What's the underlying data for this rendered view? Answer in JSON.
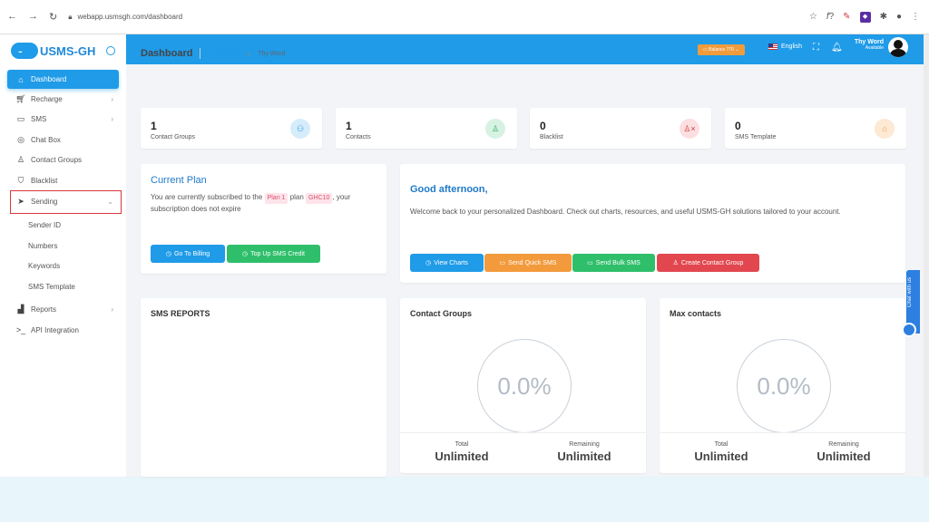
{
  "browser": {
    "url": "webapp.usmsgh.com/dashboard"
  },
  "logo": {
    "text": "USMS-GH",
    "mark": "..."
  },
  "sidebar": {
    "items": [
      {
        "label": "Dashboard",
        "icon": "home-icon"
      },
      {
        "label": "Recharge",
        "icon": "cart-icon"
      },
      {
        "label": "SMS",
        "icon": "message-icon"
      },
      {
        "label": "Chat Box",
        "icon": "chat-icon"
      },
      {
        "label": "Contact Groups",
        "icon": "user-icon"
      },
      {
        "label": "Blacklist",
        "icon": "shield-icon"
      },
      {
        "label": "Sending",
        "icon": "send-icon"
      }
    ],
    "sub_items": [
      "Sender ID",
      "Numbers",
      "Keywords",
      "SMS Template"
    ],
    "items2": [
      {
        "label": "Reports",
        "icon": "bar-chart-icon"
      },
      {
        "label": "API Integration",
        "icon": "terminal-icon"
      }
    ]
  },
  "topbar": {
    "balance": "Balance 770",
    "language": "English",
    "user_name": "Thy Word",
    "user_status": "Available"
  },
  "breadcrumb": {
    "title": "Dashboard",
    "link": "Dashboard",
    "separator": "»",
    "current": "Thy Word"
  },
  "stats": [
    {
      "value": "1",
      "label": "Contact Groups",
      "icon": "users-icon",
      "color": "#1f9be8",
      "bg": "#d6ecfb"
    },
    {
      "value": "1",
      "label": "Contacts",
      "icon": "user-icon",
      "color": "#27ae60",
      "bg": "#d7f2e2"
    },
    {
      "value": "0",
      "label": "Blacklist",
      "icon": "user-x-icon",
      "color": "#d9363e",
      "bg": "#fbdfe1"
    },
    {
      "value": "0",
      "label": "SMS Template",
      "icon": "inbox-icon",
      "color": "#f09c3c",
      "bg": "#fde9d4"
    }
  ],
  "plan": {
    "title": "Current Plan",
    "text_before": "You are currently subscribed to the",
    "plan_tag": "Plan 1",
    "text_mid": "plan",
    "price_tag": "GHC10",
    "text_after": ", your subscription does not expire",
    "billing_btn": "Go To Billing",
    "topup_btn": "Top Up SMS Credit"
  },
  "welcome": {
    "greeting": "Good afternoon,",
    "message": "Welcome back to your personalized Dashboard. Check out charts, resources, and useful USMS-GH solutions tailored to your account.",
    "buttons": [
      "View Charts",
      "Send Quick SMS",
      "Send Bulk SMS",
      "Create Contact Group"
    ]
  },
  "colors": {
    "primary": "#1f9be8",
    "green": "#2fbf6b",
    "orange": "#f39a3c",
    "red": "#e2474f",
    "highlight": "#d9363e"
  },
  "reports": {
    "title": "SMS REPORTS"
  },
  "gauges": [
    {
      "title": "Contact Groups",
      "percent": "0.0%",
      "total_label": "Total",
      "total_value": "Unlimited",
      "remaining_label": "Remaining",
      "remaining_value": "Unlimited"
    },
    {
      "title": "Max contacts",
      "percent": "0.0%",
      "total_label": "Total",
      "total_value": "Unlimited",
      "remaining_label": "Remaining",
      "remaining_value": "Unlimited"
    }
  ],
  "chat_widget": {
    "label": "Chat with us"
  }
}
